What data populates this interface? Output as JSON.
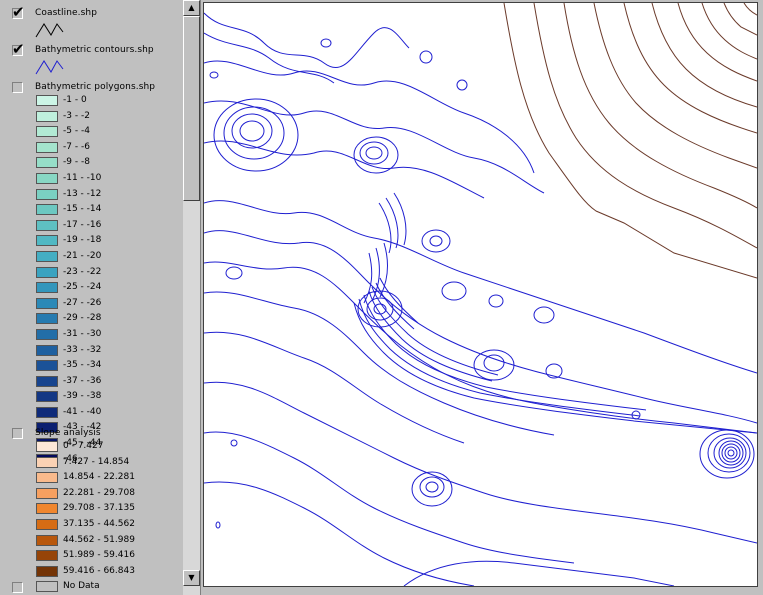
{
  "toc": {
    "layers": [
      {
        "name": "Coastline.shp",
        "checked": true
      },
      {
        "name": "Bathymetric contours.shp",
        "checked": true
      },
      {
        "name": "Bathymetric polygons.shp",
        "checked": false,
        "classes": [
          {
            "label": "-1 - 0",
            "color": "#ccf5e6"
          },
          {
            "label": "-3 - -2",
            "color": "#bff0dd"
          },
          {
            "label": "-5 - -4",
            "color": "#b2ead4"
          },
          {
            "label": "-7 - -6",
            "color": "#a4e4cd"
          },
          {
            "label": "-9 - -8",
            "color": "#96dec8"
          },
          {
            "label": "-11 - -10",
            "color": "#88d7c4"
          },
          {
            "label": "-13 - -12",
            "color": "#7ad0c2"
          },
          {
            "label": "-15 - -14",
            "color": "#6cc8c1"
          },
          {
            "label": "-17 - -16",
            "color": "#5ec0c2"
          },
          {
            "label": "-19 - -18",
            "color": "#50b8c3"
          },
          {
            "label": "-21 - -20",
            "color": "#44aec3"
          },
          {
            "label": "-23 - -22",
            "color": "#3aa3c0"
          },
          {
            "label": "-25 - -24",
            "color": "#3296bc"
          },
          {
            "label": "-27 - -26",
            "color": "#2b89b7"
          },
          {
            "label": "-29 - -28",
            "color": "#267bb0"
          },
          {
            "label": "-31 - -30",
            "color": "#226ea8"
          },
          {
            "label": "-33 - -32",
            "color": "#1e60a0"
          },
          {
            "label": "-35 - -34",
            "color": "#1b5298"
          },
          {
            "label": "-37 - -36",
            "color": "#17448e"
          },
          {
            "label": "-39 - -38",
            "color": "#133784"
          },
          {
            "label": "-41 - -40",
            "color": "#0f2b7a"
          },
          {
            "label": "-43 - -42",
            "color": "#0b1f70"
          },
          {
            "label": "-45 - -44",
            "color": "#071466"
          },
          {
            "label": "-46",
            "color": "#04095c"
          }
        ]
      },
      {
        "name": "Slope analysis",
        "checked": false,
        "classes": [
          {
            "label": "0 - 7.427",
            "color": "#fde8d8"
          },
          {
            "label": "7.427 - 14.854",
            "color": "#fbd2b4"
          },
          {
            "label": "14.854 - 22.281",
            "color": "#f9ba8c"
          },
          {
            "label": "22.281 - 29.708",
            "color": "#f7a060"
          },
          {
            "label": "29.708 - 37.135",
            "color": "#f0862e"
          },
          {
            "label": "37.135 - 44.562",
            "color": "#d66c14"
          },
          {
            "label": "44.562 - 51.989",
            "color": "#b8570c"
          },
          {
            "label": "51.989 - 59.416",
            "color": "#964408"
          },
          {
            "label": "59.416 - 66.843",
            "color": "#743406"
          },
          {
            "label": "No Data",
            "color": "#c0c0c0"
          }
        ]
      }
    ],
    "scroll_up_icon": "arrow-up-icon",
    "scroll_down_icon": "arrow-down-icon"
  },
  "map": {
    "coast_color": "#6b3a2a",
    "contour_color": "#1f1fd0"
  }
}
